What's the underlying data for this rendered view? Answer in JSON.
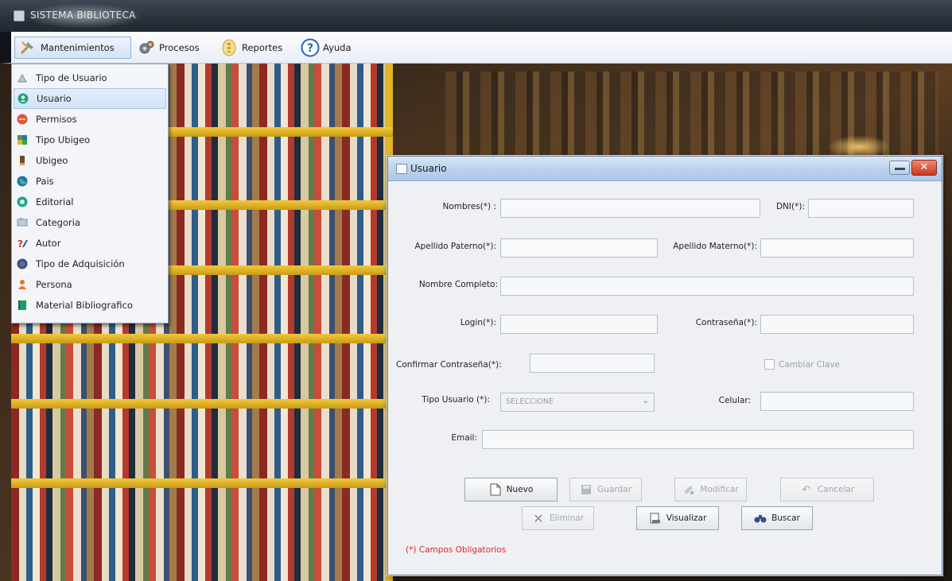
{
  "app": {
    "title": "SISTEMA BIBLIOTECA"
  },
  "menubar": {
    "items": [
      {
        "label": "Mantenimientos",
        "icon": "tools-icon",
        "active": true
      },
      {
        "label": "Procesos",
        "icon": "gears-icon"
      },
      {
        "label": "Reportes",
        "icon": "report-icon"
      },
      {
        "label": "Ayuda",
        "icon": "help-icon"
      }
    ]
  },
  "dropdown": {
    "items": [
      {
        "label": "Tipo de Usuario",
        "icon": "user-type-icon"
      },
      {
        "label": "Usuario",
        "icon": "user-icon",
        "highlighted": true
      },
      {
        "label": "Permisos",
        "icon": "permissions-icon"
      },
      {
        "label": "Tipo Ubigeo",
        "icon": "ubigeo-type-icon"
      },
      {
        "label": "Ubigeo",
        "icon": "ubigeo-icon"
      },
      {
        "label": "Pais",
        "icon": "globe-icon"
      },
      {
        "label": "Editorial",
        "icon": "editorial-icon"
      },
      {
        "label": "Categoria",
        "icon": "category-icon"
      },
      {
        "label": "Autor",
        "icon": "author-icon"
      },
      {
        "label": "Tipo de Adquisición",
        "icon": "acquisition-icon"
      },
      {
        "label": "Persona",
        "icon": "person-icon"
      },
      {
        "label": "Material Bibliografico",
        "icon": "book-icon"
      }
    ]
  },
  "form": {
    "title": "Usuario",
    "close_glyph": "✕",
    "labels": {
      "nombres": "Nombres(*) :",
      "dni": "DNI(*):",
      "apellido_paterno": "Apellido Paterno(*):",
      "apellido_materno": "Apellido Materno(*):",
      "nombre_completo": "Nombre Completo:",
      "login": "Login(*):",
      "contrasena": "Contraseña(*):",
      "confirmar": "Confirmar Contraseña(*):",
      "tipo_usuario": "Tipo Usuario (*):",
      "celular": "Celular:",
      "email": "Email:"
    },
    "values": {
      "nombres": "",
      "dni": "",
      "apellido_paterno": "",
      "apellido_materno": "",
      "nombre_completo": "",
      "login": "",
      "contrasena": "",
      "confirmar": "",
      "celular": "",
      "email": ""
    },
    "tipo_usuario_selected": "SELECCIONE",
    "cambiar_clave_label": "Cambiar Clave",
    "buttons": {
      "nuevo": "Nuevo",
      "guardar": "Guardar",
      "modificar": "Modificar",
      "cancelar": "Cancelar",
      "eliminar": "Eliminar",
      "visualizar": "Visualizar",
      "buscar": "Buscar"
    },
    "required_note": "(*) Campos Obligatorios"
  },
  "colors": {
    "accent": "#3a78c9",
    "required": "#e0262b",
    "shelf": "#e2b52a"
  }
}
